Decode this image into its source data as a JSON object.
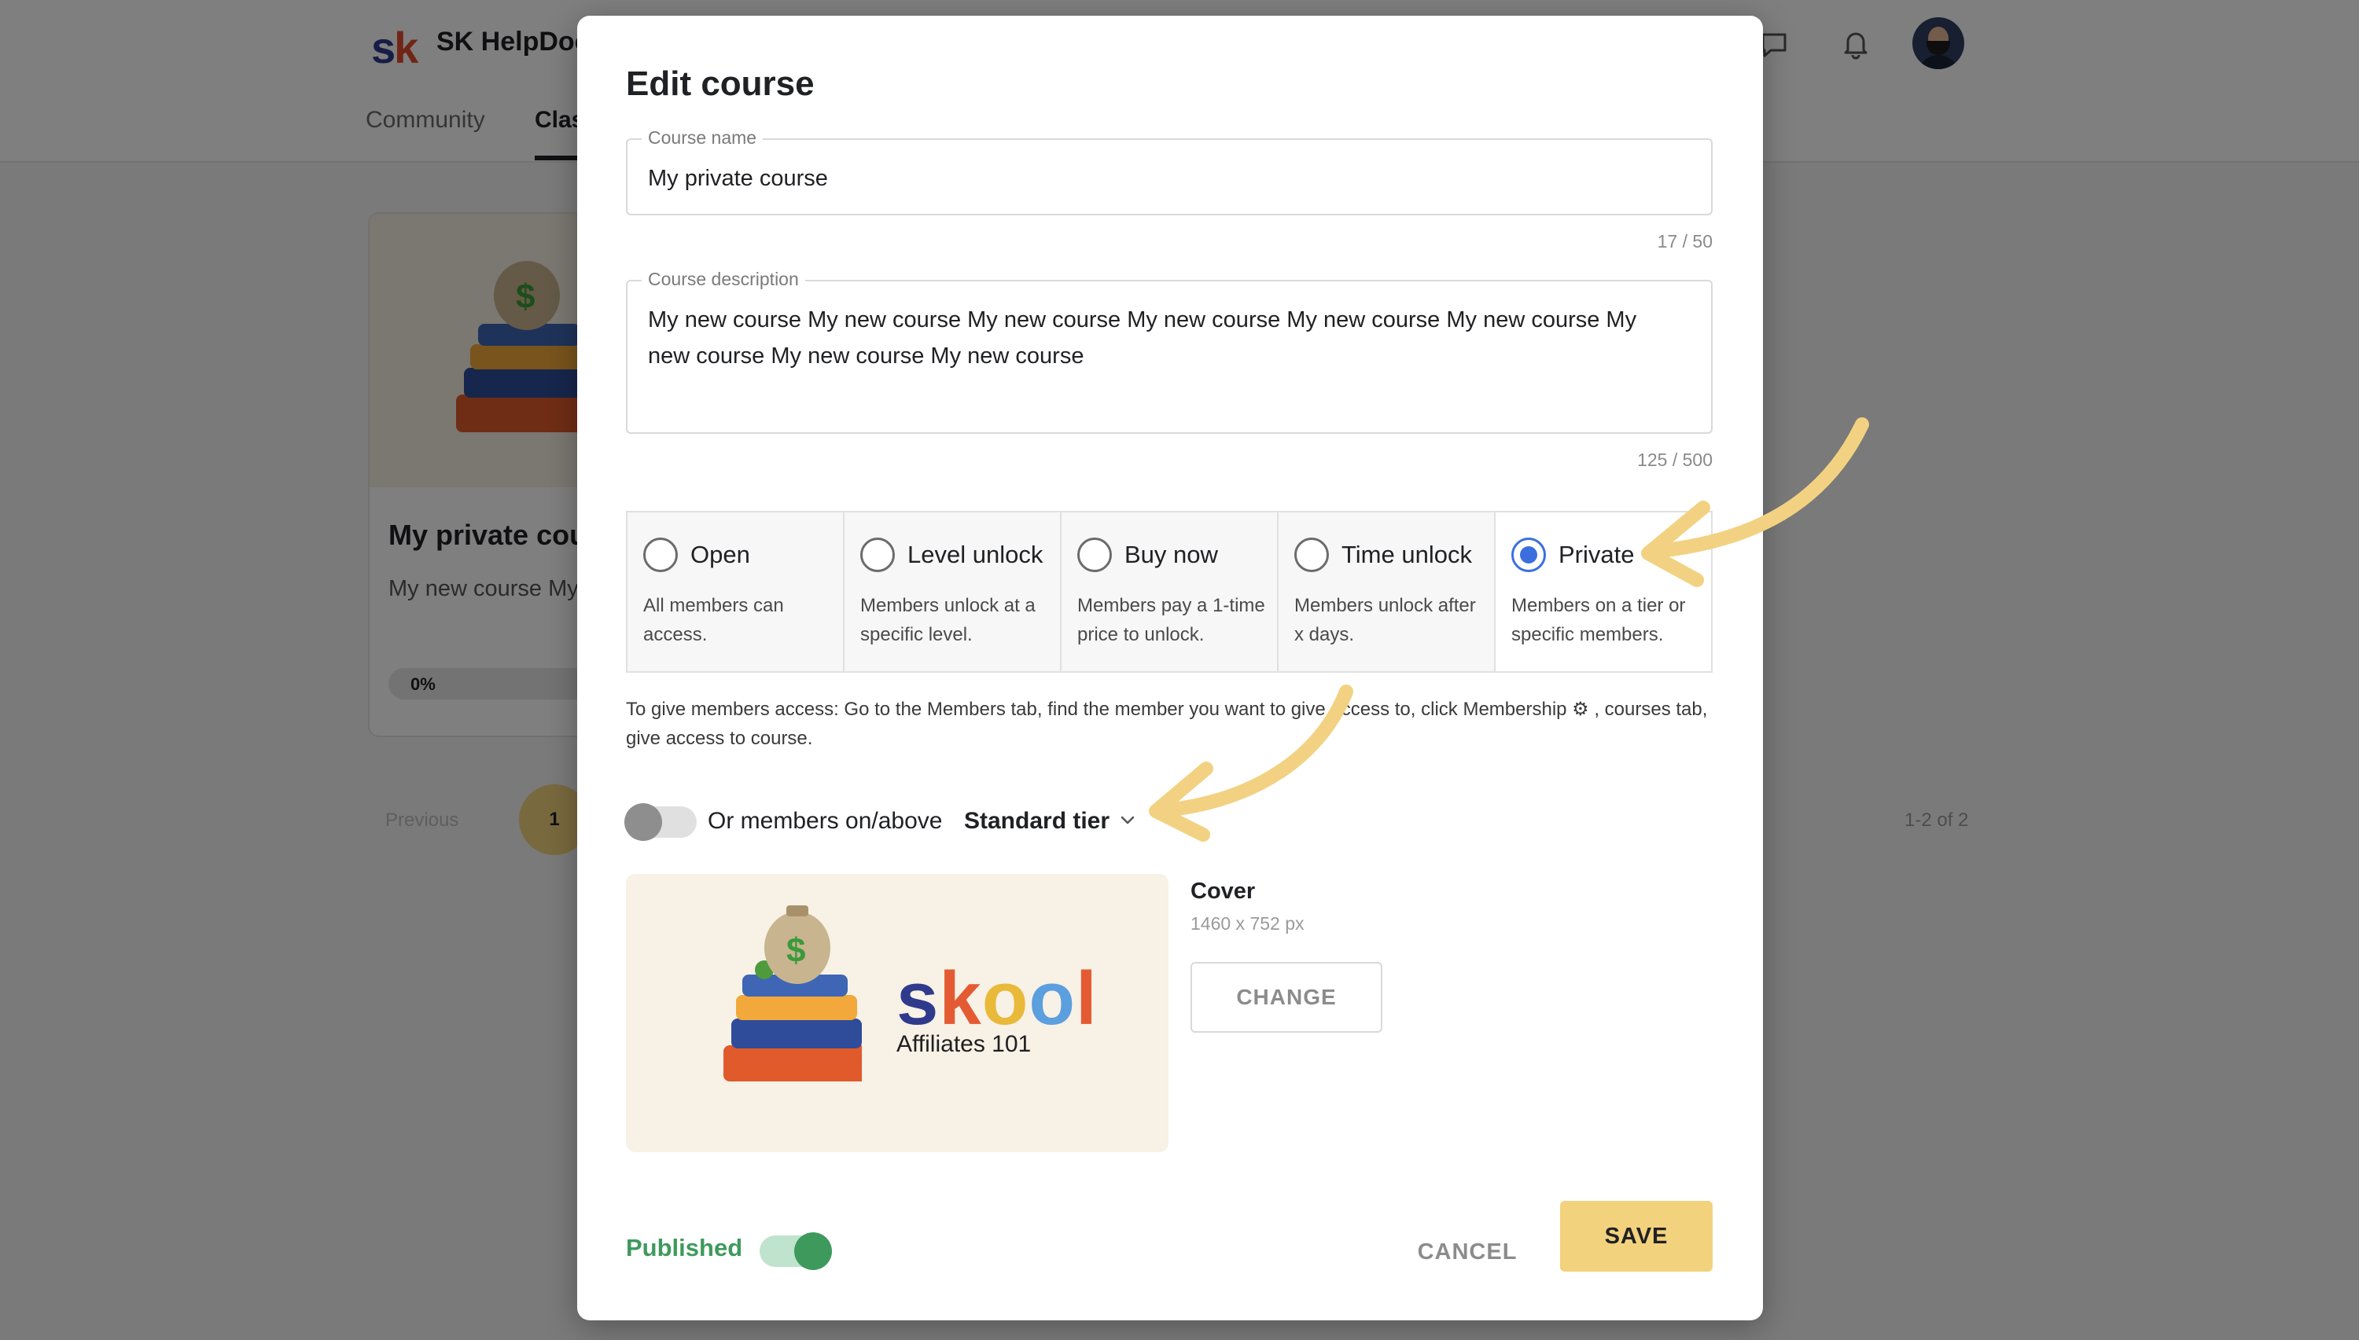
{
  "app": {
    "group_name": "SK HelpDoc",
    "nav_tabs": [
      "Community",
      "Clas"
    ],
    "logo_letters": "sk"
  },
  "background": {
    "card_title": "My private cou",
    "card_desc": "My new course My new course My new co",
    "card_progress": "0%",
    "pager_prev": "Previous",
    "pager_page": "1",
    "pager_count": "1-2 of 2"
  },
  "modal": {
    "title": "Edit course",
    "course_name": {
      "label": "Course name",
      "value": "My private course",
      "counter": "17 / 50"
    },
    "course_description": {
      "label": "Course description",
      "value": "My new course My new course My new course My new course My new course My new course My new course My new course My new course",
      "counter": "125 / 500"
    },
    "access_options": [
      {
        "label": "Open",
        "desc": "All members can access.",
        "selected": false
      },
      {
        "label": "Level unlock",
        "desc": "Members unlock at a specific level.",
        "selected": false
      },
      {
        "label": "Buy now",
        "desc": "Members pay a 1-time price to unlock.",
        "selected": false
      },
      {
        "label": "Time unlock",
        "desc": "Members unlock after x days.",
        "selected": false
      },
      {
        "label": "Private",
        "desc": "Members on a tier or specific members.",
        "selected": true
      }
    ],
    "info_text": "To give members access: Go to the Members tab, find the member you want to give access to, click Membership ⚙ , courses tab, give access to course.",
    "tier_toggle": {
      "prefix": "Or members on/above",
      "selected": "Standard tier",
      "enabled": false
    },
    "cover": {
      "title": "Cover",
      "dimensions": "1460 x 752 px",
      "change_label": "CHANGE",
      "image_brand": "skool",
      "image_subtitle": "Affiliates 101"
    },
    "published": {
      "label": "Published",
      "enabled": true
    },
    "cancel_label": "CANCEL",
    "save_label": "SAVE"
  },
  "colors": {
    "accent_yellow": "#f3d27d",
    "radio_blue": "#3b6fe0",
    "published_green": "#3e9a5c",
    "annotation_arrow": "#f2d282"
  }
}
